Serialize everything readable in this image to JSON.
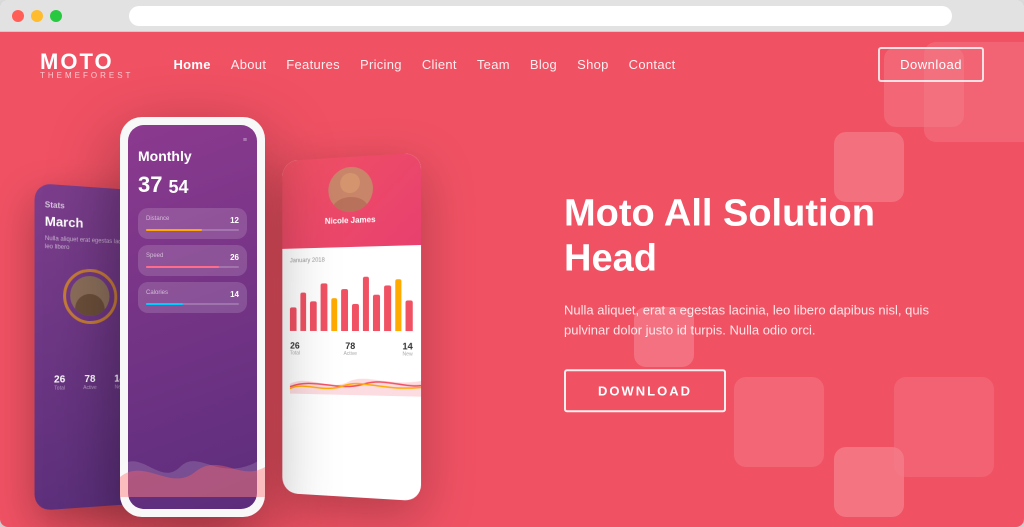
{
  "browser": {
    "dots": [
      "red",
      "yellow",
      "green"
    ]
  },
  "navbar": {
    "logo": "MOTO",
    "logo_sub": "THEMEFOREST",
    "links": [
      {
        "label": "Home",
        "active": true
      },
      {
        "label": "About",
        "active": false
      },
      {
        "label": "Features",
        "active": false
      },
      {
        "label": "Pricing",
        "active": false
      },
      {
        "label": "Client",
        "active": false
      },
      {
        "label": "Team",
        "active": false
      },
      {
        "label": "Blog",
        "active": false
      },
      {
        "label": "Shop",
        "active": false
      },
      {
        "label": "Contact",
        "active": false
      }
    ],
    "download_button": "Download"
  },
  "hero": {
    "title": "Moto All Solution Head",
    "description": "Nulla aliquet, erat a egestas lacinia, leo libero dapibus nisl, quis pulvinar dolor justo id turpis. Nulla odio orci.",
    "cta_button": "DOWNLOAD",
    "bg_color": "#f05163"
  },
  "phone_left": {
    "title": "March",
    "numbers": [
      {
        "val": "26",
        "label": ""
      },
      {
        "val": "78",
        "label": ""
      },
      {
        "val": "14",
        "label": ""
      }
    ]
  },
  "phone_main": {
    "title": "Monthly",
    "stat1": "37",
    "stat2": "54"
  },
  "card_right": {
    "name": "Nicole James",
    "date": "January 2018",
    "bars": [
      40,
      65,
      50,
      80,
      55,
      70,
      45,
      90,
      60,
      75,
      85,
      50
    ],
    "stats": [
      {
        "val": "26",
        "label": ""
      },
      {
        "val": "78",
        "label": ""
      },
      {
        "val": "14",
        "label": ""
      }
    ]
  }
}
